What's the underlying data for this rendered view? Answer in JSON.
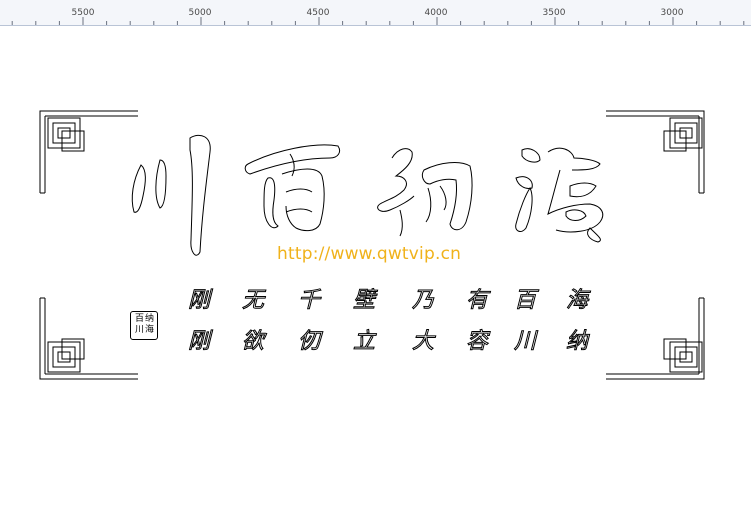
{
  "ruler": {
    "labels": [
      "5500",
      "5000",
      "4500",
      "4000",
      "3500",
      "3000"
    ]
  },
  "artwork": {
    "url": "http://www.qwtvip.cn",
    "title_chars": [
      "川",
      "百",
      "纳",
      "海"
    ],
    "poem_row1": [
      "刚",
      "无",
      "千",
      "壁",
      "乃",
      "有",
      "百",
      "海"
    ],
    "poem_row2": [
      "刚",
      "欲",
      "仞",
      "立",
      "大",
      "容",
      "川",
      "纳"
    ],
    "seal_chars": [
      "百",
      "纳",
      "川",
      "海"
    ]
  },
  "colors": {
    "url": "#f0b21b",
    "ruler_bg": "#f4f6fa",
    "stroke": "#000000"
  }
}
